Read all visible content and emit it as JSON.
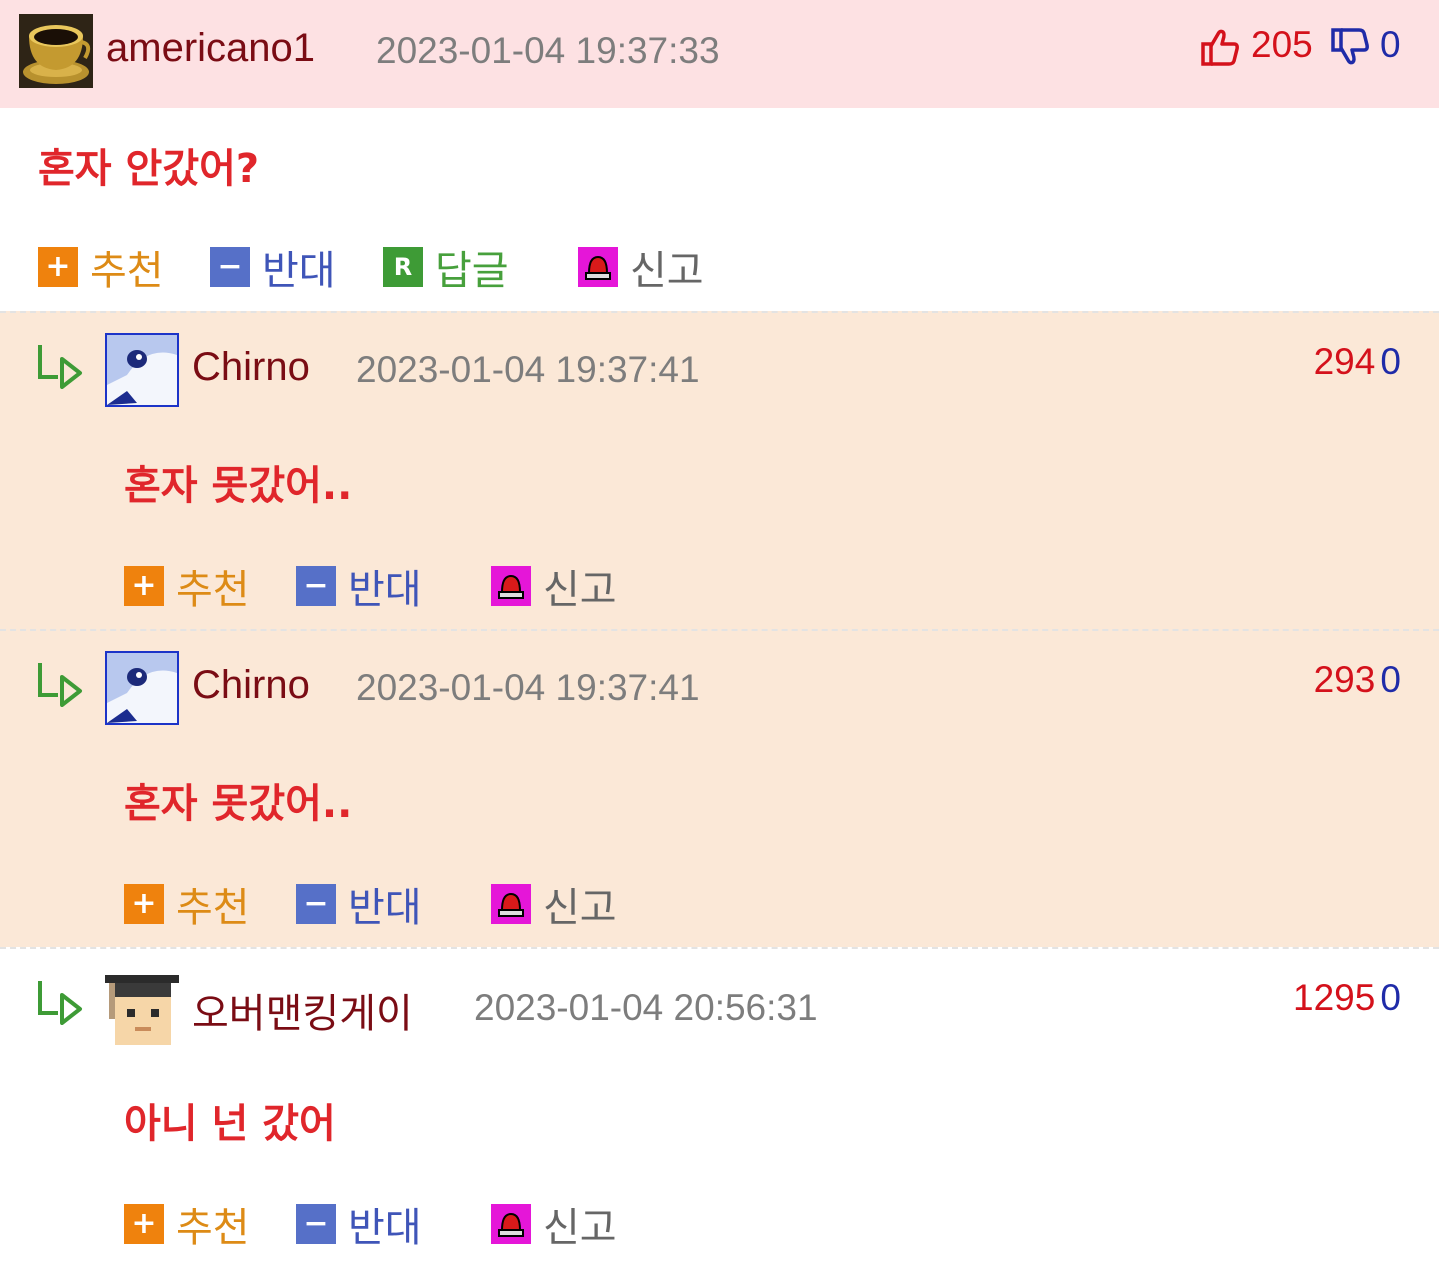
{
  "colors": {
    "top_bg": "#fde1e3",
    "reply_bg": "#fbe8d7",
    "nick": "#7a0c14",
    "date": "#7d7d7d",
    "message": "#e0262b",
    "up_count": "#d4111b",
    "down_count": "#1f2ba8"
  },
  "labels": {
    "recommend": "추천",
    "oppose": "반대",
    "reply": "답글",
    "report": "신고",
    "reply_icon_letter": "R",
    "plus": "+",
    "minus": "−"
  },
  "top_comment": {
    "nickname": "americano1",
    "avatar": "coffee-cup-avatar",
    "date": "2023-01-04 19:37:33",
    "up": "205",
    "down": "0",
    "message": "혼자 안갔어?"
  },
  "replies": [
    {
      "nickname": "Chirno",
      "avatar": "anime-girl-avatar",
      "date": "2023-01-04 19:37:41",
      "up": "294",
      "down": "0",
      "message": "혼자 못갔어.."
    },
    {
      "nickname": "Chirno",
      "avatar": "anime-girl-avatar",
      "date": "2023-01-04 19:37:41",
      "up": "293",
      "down": "0",
      "message": "혼자 못갔어.."
    },
    {
      "nickname": "오버맨킹게이",
      "avatar": "graduate-pixel-avatar",
      "date": "2023-01-04 20:56:31",
      "up": "1295",
      "down": "0",
      "message": "아니 넌 갔어"
    }
  ]
}
